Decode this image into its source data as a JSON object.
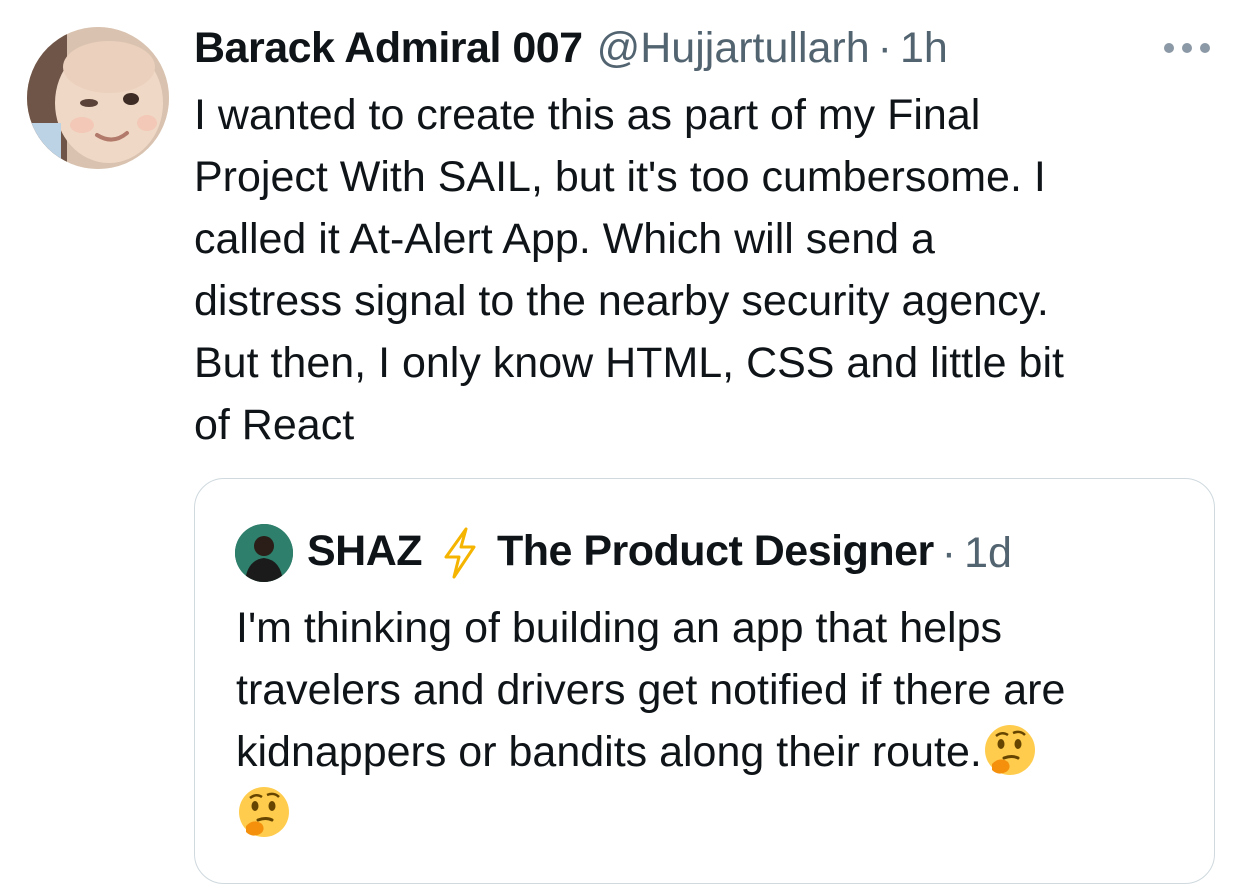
{
  "tweet": {
    "display_name": "Barack Admiral 007",
    "handle": "@Hujjartullarh",
    "separator": "·",
    "time": "1h",
    "more_icon": "more-horizontal-icon",
    "avatar_icon": "user-avatar-baby",
    "text": "I wanted to create this as part of my Final\nProject With SAIL, but it's too cumbersome. I\ncalled it At-Alert App. Which will send a\ndistress signal to the nearby security agency.\nBut then, I only know HTML, CSS and little bit\nof React"
  },
  "quote": {
    "name_part1": "SHAZ",
    "name_part2": "The Product Designer",
    "separator": "·",
    "time": "1d",
    "bolt_icon": "lightning-bolt-icon",
    "text": "I'm thinking of building an app that helps\ntravelers and drivers get notified if there are\nkidnappers or bandits along their route.",
    "emoji_icon": "thinking-face-emoji"
  },
  "colors": {
    "text": "#0f1419",
    "secondary": "#536471",
    "border": "#cfd9de",
    "bolt": "#f4b400"
  }
}
